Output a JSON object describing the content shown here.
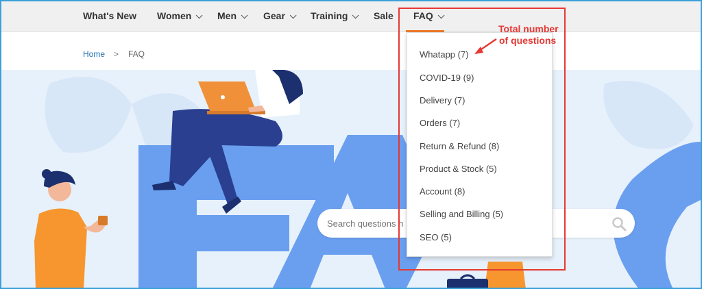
{
  "nav": {
    "items": [
      {
        "label": "What's New",
        "has_chevron": false
      },
      {
        "label": "Women",
        "has_chevron": true
      },
      {
        "label": "Men",
        "has_chevron": true
      },
      {
        "label": "Gear",
        "has_chevron": true
      },
      {
        "label": "Training",
        "has_chevron": true
      },
      {
        "label": "Sale",
        "has_chevron": false
      },
      {
        "label": "FAQ",
        "has_chevron": true,
        "active": true
      }
    ],
    "active_color": "#f07a2a"
  },
  "breadcrumb": {
    "home": "Home",
    "separator": ">",
    "current": "FAQ"
  },
  "faq_dropdown": {
    "items": [
      "Whatapp (7)",
      "COVID-19 (9)",
      "Delivery (7)",
      "Orders (7)",
      "Return & Refund (8)",
      "Product & Stock (5)",
      "Account (8)",
      "Selling and Billing (5)",
      "SEO (5)"
    ]
  },
  "search": {
    "placeholder": "Search questions h"
  },
  "annotation": {
    "line1": "Total number",
    "line2": "of questions",
    "color": "#e53935"
  },
  "colors": {
    "hero_bg": "#e7f1fb",
    "hero_letters": "#6a9ff0",
    "accent": "#f07a2a",
    "link": "#1f6fb0"
  }
}
